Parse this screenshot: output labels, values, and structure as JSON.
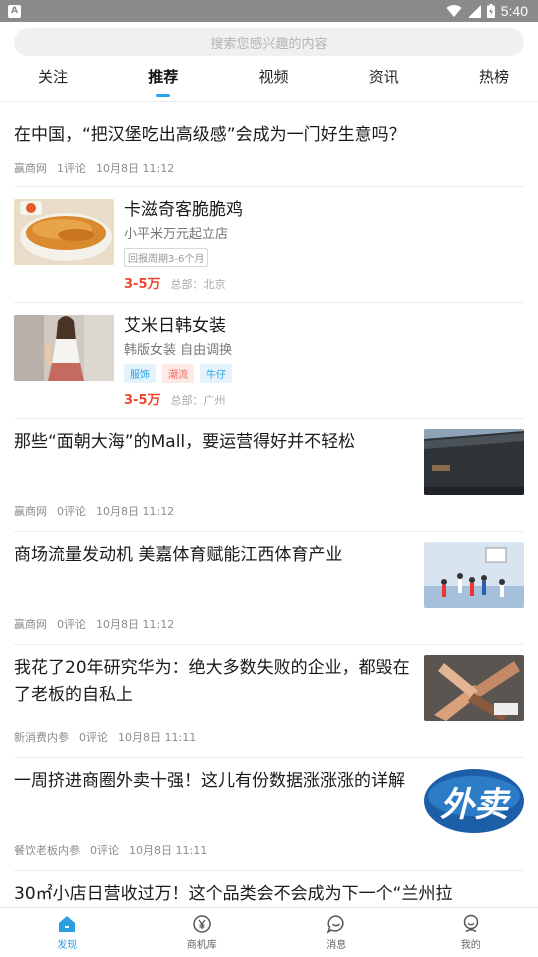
{
  "status_bar": {
    "time": "5:40"
  },
  "search": {
    "placeholder": "搜索您感兴趣的内容"
  },
  "tabs": [
    {
      "label": "关注"
    },
    {
      "label": "推荐",
      "active": true
    },
    {
      "label": "视频"
    },
    {
      "label": "资讯"
    },
    {
      "label": "热榜"
    }
  ],
  "feed": {
    "article1": {
      "title": "在中国，“把汉堡吃出高级感”会成为一门好生意吗？",
      "source": "赢商网",
      "comments": "1评论",
      "time": "10月8日 11:12"
    },
    "shop1": {
      "name": "卡滋奇客脆脆鸡",
      "desc": "小平米万元起立店",
      "tag": "回报周期3-6个月",
      "price": "3-5万",
      "hq": "总部：北京"
    },
    "shop2": {
      "name": "艾米日韩女装",
      "desc": "韩版女装 自由调换",
      "tags": [
        "服饰",
        "潮流",
        "牛仔"
      ],
      "price": "3-5万",
      "hq": "总部：广州"
    },
    "news1": {
      "title": "那些“面朝大海”的Mall，要运营得好并不轻松",
      "source": "赢商网",
      "comments": "0评论",
      "time": "10月8日 11:12"
    },
    "news2": {
      "title": "商场流量发动机 美嘉体育赋能江西体育产业",
      "source": "赢商网",
      "comments": "0评论",
      "time": "10月8日 11:12"
    },
    "news3": {
      "title": "我花了20年研究华为：绝大多数失败的企业，都毁在了老板的自私上",
      "source": "新消费内参",
      "comments": "0评论",
      "time": "10月8日 11:11"
    },
    "news4": {
      "title": "一周挤进商圈外卖十强！这儿有份数据涨涨涨的详解",
      "source": "餐饮老板内参",
      "comments": "0评论",
      "time": "10月8日 11:11",
      "thumb_text": "外卖"
    },
    "partial": {
      "title": "30㎡小店日营收过万！这个品类会不会成为下一个“兰州拉"
    }
  },
  "bottom_nav": [
    {
      "label": "发现",
      "icon": "home-icon",
      "active": true
    },
    {
      "label": "商机库",
      "icon": "yuan-icon"
    },
    {
      "label": "消息",
      "icon": "chat-icon"
    },
    {
      "label": "我的",
      "icon": "user-icon"
    }
  ],
  "colors": {
    "accent": "#2aa4f0",
    "price": "#f0452f"
  }
}
